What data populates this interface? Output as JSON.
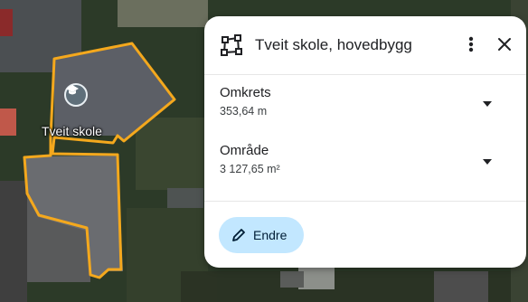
{
  "map": {
    "place_label": "Tveit skole",
    "outline_color": "#f4a81d"
  },
  "card": {
    "title": "Tveit skole, hovedbygg",
    "icons": {
      "shape": "polygon-icon",
      "more": "more-vert-icon",
      "close": "close-icon",
      "edit": "pencil-icon"
    },
    "metrics": [
      {
        "label": "Omkrets",
        "value": "353,64 m"
      },
      {
        "label": "Område",
        "value": "3 127,65 m²"
      }
    ],
    "edit_label": "Endre",
    "edit_button_color": "#c2e7ff"
  }
}
